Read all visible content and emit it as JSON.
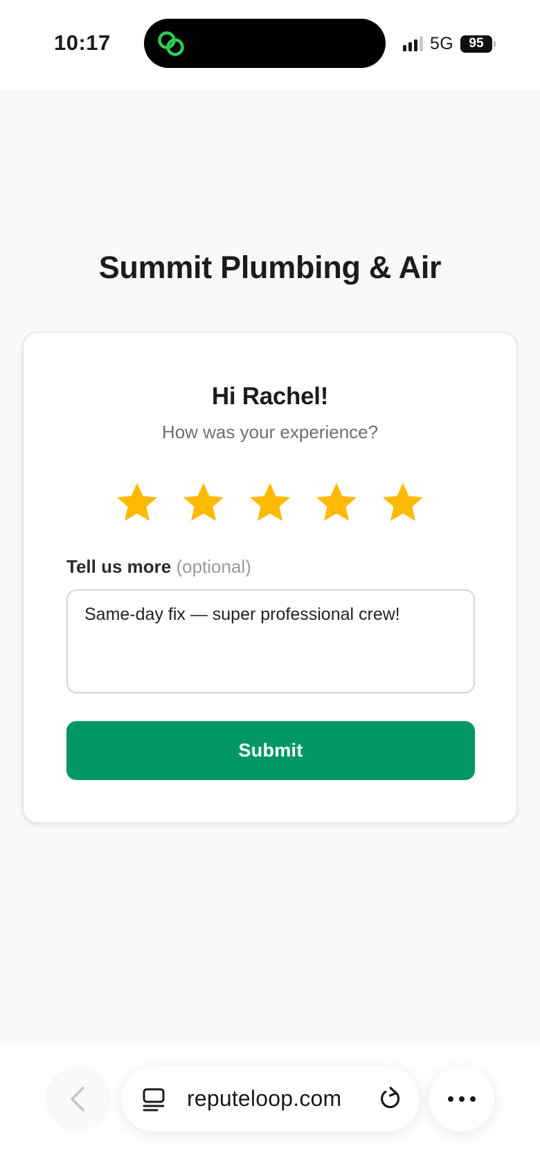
{
  "status_bar": {
    "time": "10:17",
    "network": "5G",
    "battery": "95",
    "signal_bars_active": 3,
    "signal_bars_total": 4
  },
  "page": {
    "business_name": "Summit Plumbing & Air",
    "greeting": "Hi Rachel!",
    "question": "How was your experience?",
    "rating": {
      "value": 5,
      "max": 5,
      "star_color": "#FFB900"
    },
    "feedback_label": "Tell us more",
    "feedback_optional": "(optional)",
    "feedback_value": "Same-day fix — super professional crew!",
    "submit_label": "Submit",
    "accent_color": "#039766"
  },
  "browser": {
    "url": "reputeloop.com",
    "icons": [
      "back-chevron-icon",
      "tabs-icon",
      "reload-icon",
      "more-icon"
    ]
  }
}
